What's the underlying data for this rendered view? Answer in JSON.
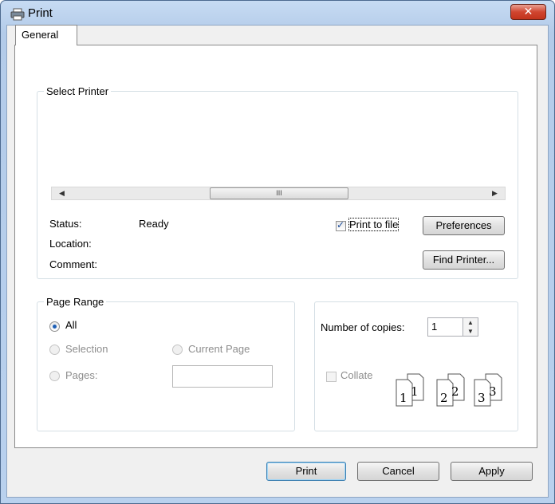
{
  "window": {
    "title": "Print",
    "close_glyph": "✕"
  },
  "tabs": [
    {
      "label": "General"
    }
  ],
  "select_printer": {
    "legend": "Select Printer",
    "scroll": {
      "left_arrow": "◀",
      "right_arrow": "▶",
      "grip": "III"
    },
    "status_label": "Status:",
    "status_value": "Ready",
    "location_label": "Location:",
    "comment_label": "Comment:",
    "print_to_file_label": "Print to file",
    "print_to_file_checked": true,
    "preferences_label": "Preferences",
    "find_printer_label": "Find Printer..."
  },
  "page_range": {
    "legend": "Page Range",
    "options": [
      {
        "label": "All",
        "selected": true,
        "enabled": true
      },
      {
        "label": "Selection",
        "selected": false,
        "enabled": false
      },
      {
        "label": "Current Page",
        "selected": false,
        "enabled": false
      },
      {
        "label": "Pages:",
        "selected": false,
        "enabled": false
      }
    ],
    "pages_value": ""
  },
  "copies": {
    "label": "Number of copies:",
    "value": "1",
    "collate_label": "Collate",
    "collate_checked": false,
    "collate_pages": [
      "1",
      "1",
      "2",
      "2",
      "3",
      "3"
    ]
  },
  "footer": {
    "print_label": "Print",
    "cancel_label": "Cancel",
    "apply_label": "Apply"
  },
  "colors": {
    "title_bg": "#b9d1ee",
    "close_red": "#d0452f",
    "radio_selected": "#1e5fb5"
  },
  "icons": [
    "printer-icon",
    "close-icon",
    "spin-up-icon",
    "spin-down-icon",
    "collate-pages-icon"
  ]
}
